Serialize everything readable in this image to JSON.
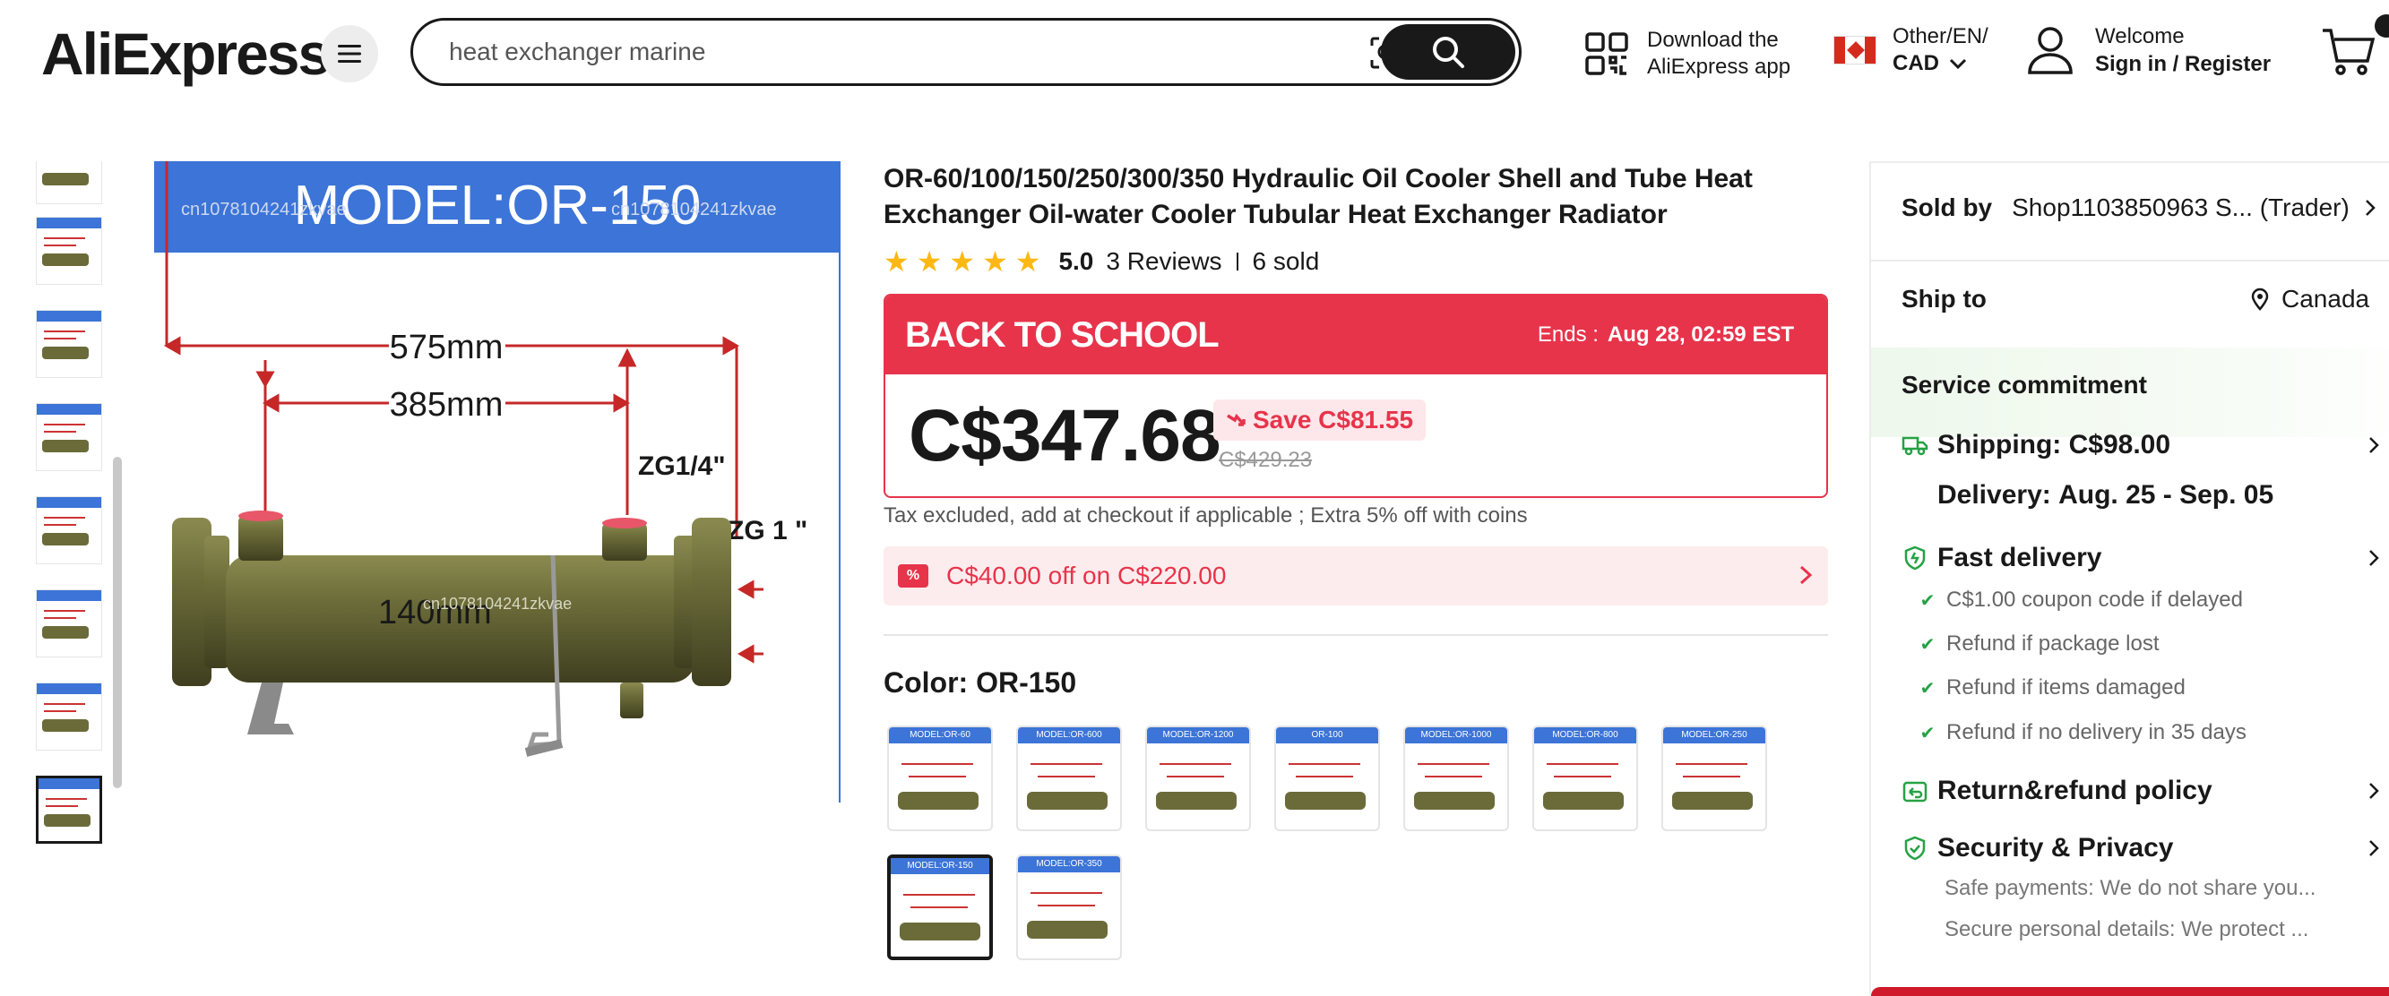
{
  "header": {
    "logo": "AliExpress",
    "search": {
      "value": "heat exchanger marine"
    },
    "app_download": {
      "line1": "Download the",
      "line2": "AliExpress app"
    },
    "locale": {
      "line1": "Other/EN/",
      "line2": "CAD"
    },
    "account": {
      "line1": "Welcome",
      "line2": "Sign in / Register"
    }
  },
  "gallery": {
    "thumbnail_count": 8,
    "main_image": {
      "title": "MODEL:OR-150",
      "watermark": "cn1078104241zkvae",
      "dims": [
        "575mm",
        "385mm",
        "ZG1/4\"",
        "ZG 1  \"",
        "140mm"
      ]
    }
  },
  "product": {
    "title": "OR-60/100/150/250/300/350 Hydraulic Oil Cooler Shell and Tube Heat Exchanger Oil-water Cooler Tubular Heat Exchanger Radiator",
    "rating": "5.0",
    "reviews": "3 Reviews",
    "sold": "6 sold",
    "promo": {
      "title": "BACK TO SCHOOL",
      "ends_label": "Ends :",
      "ends_value": "Aug 28, 02:59 EST",
      "price": "C$347.68",
      "save": "Save C$81.55",
      "original_price": "C$429.23"
    },
    "tax_note": "Tax excluded, add at checkout if applicable ; Extra 5% off with coins",
    "coupon": "C$40.00 off on C$220.00",
    "color_label": "Color: OR-150",
    "swatches": [
      {
        "label": "MODEL:OR-60"
      },
      {
        "label": "MODEL:OR-600"
      },
      {
        "label": "MODEL:OR-1200"
      },
      {
        "label": "OR-100"
      },
      {
        "label": "MODEL:OR-1000"
      },
      {
        "label": "MODEL:OR-800"
      },
      {
        "label": "MODEL:OR-250"
      },
      {
        "label": "MODEL:OR-150"
      },
      {
        "label": "MODEL:OR-350"
      }
    ],
    "selected_swatch": "MODEL:OR-150"
  },
  "side_panel": {
    "sold_by_label": "Sold by",
    "sold_by_value": "Shop1103850963 S... (Trader)",
    "ship_to_label": "Ship to",
    "ship_to_value": "Canada",
    "service_title": "Service commitment",
    "shipping": "Shipping: C$98.00",
    "delivery_label": "Delivery:",
    "delivery_value": "Aug. 25 - Sep. 05",
    "fast_delivery": "Fast delivery",
    "fast_items": [
      "C$1.00 coupon code if delayed",
      "Refund if package lost",
      "Refund if items damaged",
      "Refund if no delivery in 35 days"
    ],
    "return_policy": "Return&refund policy",
    "security": "Security & Privacy",
    "security_items": [
      "Safe payments: We do not share you...",
      "Secure personal details: We protect ..."
    ]
  },
  "colors": {
    "accent": "#e7344b",
    "text": "#191919",
    "star": "#fdb813",
    "check": "#25a244",
    "banner_blue": "#3c74d7",
    "tube_olive": "#6b6b3a"
  }
}
